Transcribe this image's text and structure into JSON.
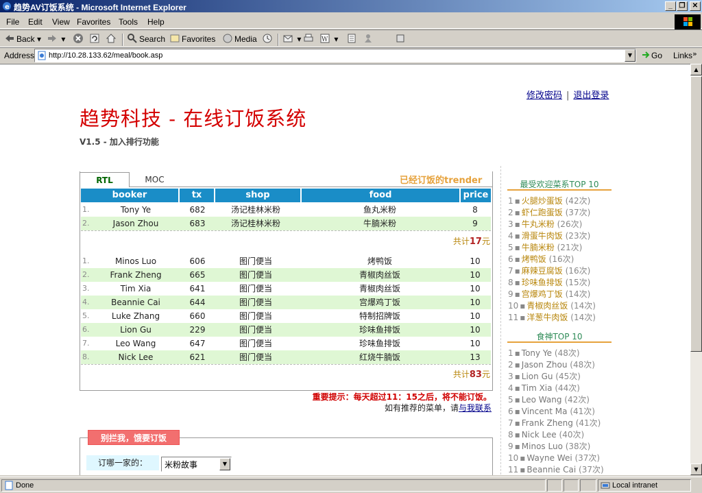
{
  "window": {
    "title": "趋势AV订饭系统 - Microsoft Internet Explorer"
  },
  "menu": [
    "File",
    "Edit",
    "View",
    "Favorites",
    "Tools",
    "Help"
  ],
  "toolbar": {
    "back": "Back",
    "search": "Search",
    "favorites": "Favorites",
    "media": "Media"
  },
  "address": {
    "label": "Address",
    "url": "http://10.28.133.62/meal/book.asp",
    "go": "Go",
    "links": "Links"
  },
  "status": {
    "text": "Done",
    "zone": "Local intranet"
  },
  "page": {
    "change_password": "修改密码",
    "separator": "|",
    "logout": "退出登录",
    "title": "趋势科技 - 在线订饭系统",
    "subtitle": "V1.5 - 加入排行功能",
    "tabs": [
      "RTL",
      "MOC"
    ],
    "ordered_title": "已经订饭的trender",
    "columns": [
      "booker",
      "tx",
      "shop",
      "food",
      "price"
    ],
    "group1": {
      "rows": [
        {
          "idx": "1.",
          "booker": "Tony Ye",
          "tx": "682",
          "shop": "汤记桂林米粉",
          "food": "鱼丸米粉",
          "price": "8"
        },
        {
          "idx": "2.",
          "booker": "Jason Zhou",
          "tx": "683",
          "shop": "汤记桂林米粉",
          "food": "牛腩米粉",
          "price": "9"
        }
      ],
      "total_prefix": "共计",
      "total": "17",
      "total_suffix": "元"
    },
    "group2": {
      "rows": [
        {
          "idx": "1.",
          "booker": "Minos Luo",
          "tx": "606",
          "shop": "图门便当",
          "food": "烤鸭饭",
          "price": "10"
        },
        {
          "idx": "2.",
          "booker": "Frank Zheng",
          "tx": "665",
          "shop": "图门便当",
          "food": "青椒肉丝饭",
          "price": "10"
        },
        {
          "idx": "3.",
          "booker": "Tim Xia",
          "tx": "641",
          "shop": "图门便当",
          "food": "青椒肉丝饭",
          "price": "10"
        },
        {
          "idx": "4.",
          "booker": "Beannie Cai",
          "tx": "644",
          "shop": "图门便当",
          "food": "宫爆鸡丁饭",
          "price": "10"
        },
        {
          "idx": "5.",
          "booker": "Luke Zhang",
          "tx": "660",
          "shop": "图门便当",
          "food": "特制招牌饭",
          "price": "10"
        },
        {
          "idx": "6.",
          "booker": "Lion Gu",
          "tx": "229",
          "shop": "图门便当",
          "food": "珍味鱼排饭",
          "price": "10"
        },
        {
          "idx": "7.",
          "booker": "Leo Wang",
          "tx": "647",
          "shop": "图门便当",
          "food": "珍味鱼排饭",
          "price": "10"
        },
        {
          "idx": "8.",
          "booker": "Nick Lee",
          "tx": "621",
          "shop": "图门便当",
          "food": "红烧牛腩饭",
          "price": "13"
        }
      ],
      "total_prefix": "共计",
      "total": "83",
      "total_suffix": "元"
    },
    "notice": "重要提示：每天超过11：15之后，将不能订饭。",
    "recommend_prefix": "如有推荐的菜单，请",
    "recommend_link": "与我联系",
    "form": {
      "legend": "别拦我，饿要订饭",
      "label": "订哪一家的：",
      "selected": "米粉故事"
    },
    "dish_rank": {
      "title": "最受欢迎菜系TOP 10",
      "items": [
        {
          "num": "1",
          "name": "火腿炒蛋饭",
          "count": "(42次)"
        },
        {
          "num": "2",
          "name": "虾仁跑蛋饭",
          "count": "(37次)"
        },
        {
          "num": "3",
          "name": "牛丸米粉",
          "count": "(26次)"
        },
        {
          "num": "4",
          "name": "滑蛋牛肉饭",
          "count": "(23次)"
        },
        {
          "num": "5",
          "name": "牛腩米粉",
          "count": "(21次)"
        },
        {
          "num": "6",
          "name": "烤鸭饭",
          "count": "(16次)"
        },
        {
          "num": "7",
          "name": "麻辣豆腐饭",
          "count": "(16次)"
        },
        {
          "num": "8",
          "name": "珍味鱼排饭",
          "count": "(15次)"
        },
        {
          "num": "9",
          "name": "宫爆鸡丁饭",
          "count": "(14次)"
        },
        {
          "num": "10",
          "name": "青椒肉丝饭",
          "count": "(14次)"
        },
        {
          "num": "11",
          "name": "洋葱牛肉饭",
          "count": "(14次)"
        }
      ]
    },
    "eater_rank": {
      "title": "食神TOP 10",
      "items": [
        {
          "num": "1",
          "name": "Tony Ye",
          "count": "(48次)"
        },
        {
          "num": "2",
          "name": "Jason Zhou",
          "count": "(48次)"
        },
        {
          "num": "3",
          "name": "Lion Gu",
          "count": "(45次)"
        },
        {
          "num": "4",
          "name": "Tim Xia",
          "count": "(44次)"
        },
        {
          "num": "5",
          "name": "Leo Wang",
          "count": "(42次)"
        },
        {
          "num": "6",
          "name": "Vincent Ma",
          "count": "(41次)"
        },
        {
          "num": "7",
          "name": "Frank Zheng",
          "count": "(41次)"
        },
        {
          "num": "8",
          "name": "Nick Lee",
          "count": "(40次)"
        },
        {
          "num": "9",
          "name": "Minos Luo",
          "count": "(38次)"
        },
        {
          "num": "10",
          "name": "Wayne Wei",
          "count": "(37次)"
        },
        {
          "num": "11",
          "name": "Beannie Cai",
          "count": "(37次)"
        }
      ]
    }
  }
}
